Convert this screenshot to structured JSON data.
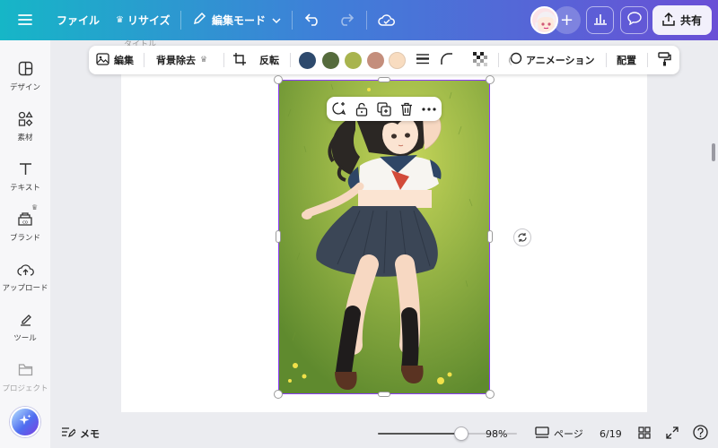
{
  "topbar": {
    "menu_icon": "hamburger-icon",
    "file_label": "ファイル",
    "resize_label": "リサイズ",
    "edit_mode_label": "編集モード",
    "share_label": "共有"
  },
  "ghost_text": "タイトル",
  "sidebar": {
    "items": [
      {
        "label": "デザイン",
        "icon": "design-icon"
      },
      {
        "label": "素材",
        "icon": "elements-icon"
      },
      {
        "label": "テキスト",
        "icon": "text-icon"
      },
      {
        "label": "ブランド",
        "icon": "brand-icon"
      },
      {
        "label": "アップロード",
        "icon": "upload-icon"
      },
      {
        "label": "ツール",
        "icon": "tools-icon"
      },
      {
        "label": "プロジェクト",
        "icon": "projects-icon"
      }
    ]
  },
  "context_toolbar": {
    "edit_label": "編集",
    "bg_remove_label": "背景除去",
    "flip_label": "反転",
    "animation_label": "アニメーション",
    "position_label": "配置",
    "swatches": [
      "#2e4a6d",
      "#556b3c",
      "#a8b44e",
      "#c48e7c",
      "#f8dcc0"
    ]
  },
  "floating_bar": {
    "icons": [
      "comment-add-icon",
      "lock-icon",
      "duplicate-icon",
      "trash-icon",
      "more-icon"
    ]
  },
  "bottombar": {
    "notes_label": "メモ",
    "zoom_label": "98%",
    "zoom_fraction": 0.6,
    "pages_label": "ページ",
    "page_count": "6/19"
  },
  "colors": {
    "accent": "#8b3dff",
    "gradient_start": "#16b6c7",
    "gradient_end": "#6a4fd6"
  }
}
